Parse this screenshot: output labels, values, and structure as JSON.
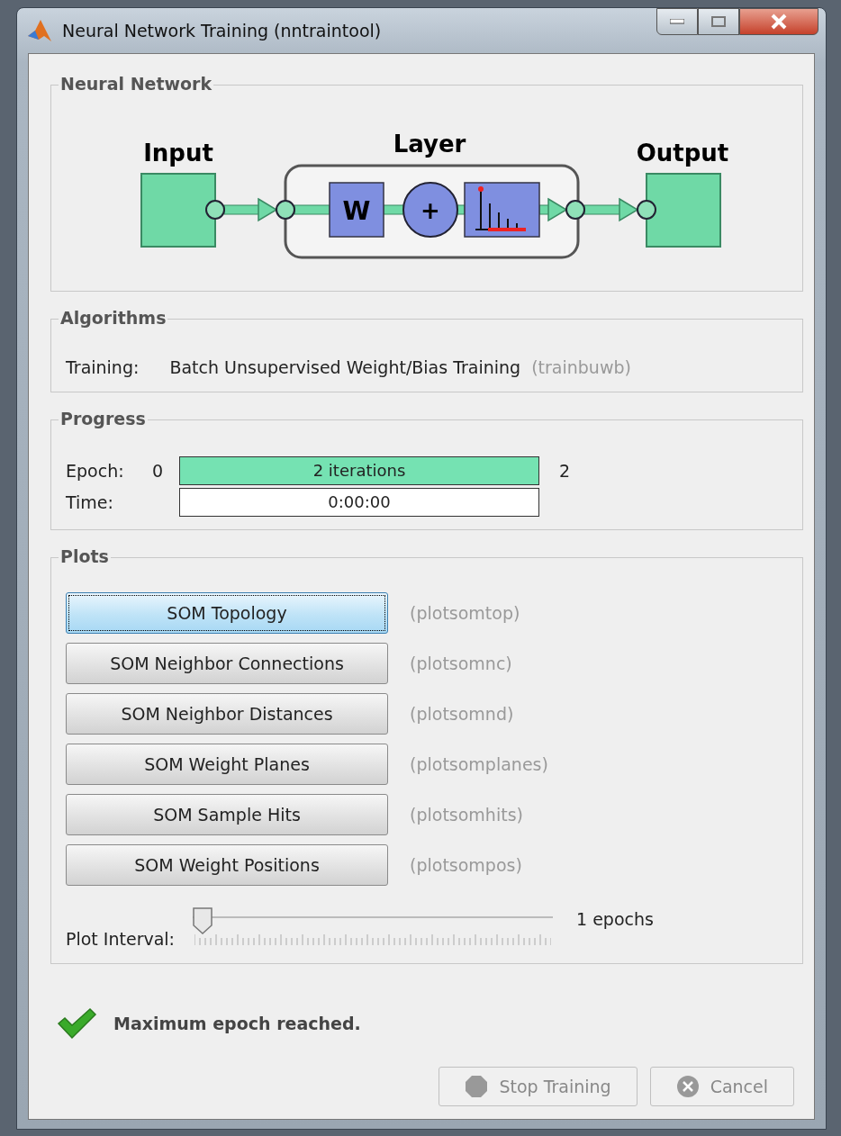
{
  "window": {
    "title": "Neural Network Training (nntraintool)"
  },
  "network": {
    "title": "Neural Network",
    "input_label": "Input",
    "layer_label": "Layer",
    "weight_label": "W",
    "sum_label": "+",
    "output_label": "Output"
  },
  "algorithms": {
    "title": "Algorithms",
    "rows": [
      {
        "label": "Training:",
        "value": "Batch Unsupervised Weight/Bias Training",
        "function": "(trainbuwb)"
      }
    ]
  },
  "progress": {
    "title": "Progress",
    "rows": [
      {
        "kind": "bar",
        "label": "Epoch:",
        "start": "0",
        "text": "2 iterations",
        "level": 1,
        "end": "2"
      },
      {
        "kind": "field",
        "label": "Time:",
        "text": "0:00:00"
      }
    ]
  },
  "plots": {
    "title": "Plots",
    "buttons": [
      {
        "label": "SOM Topology",
        "function": "(plotsomtop)",
        "selected": true
      },
      {
        "label": "SOM Neighbor Connections",
        "function": "(plotsomnc)",
        "selected": false
      },
      {
        "label": "SOM Neighbor Distances",
        "function": "(plotsomnd)",
        "selected": false
      },
      {
        "label": "SOM Weight Planes",
        "function": "(plotsomplanes)",
        "selected": false
      },
      {
        "label": "SOM Sample Hits",
        "function": "(plotsomhits)",
        "selected": false
      },
      {
        "label": "SOM Weight Positions",
        "function": "(plotsompos)",
        "selected": false
      }
    ],
    "interval": {
      "label": "Plot Interval:",
      "level": 0,
      "reading": "1 epochs"
    }
  },
  "status": {
    "message": "Maximum epoch reached."
  },
  "buttons": [
    {
      "kind": "stop",
      "label": "Stop Training",
      "disabled": true
    },
    {
      "kind": "cancel",
      "label": "Cancel",
      "disabled": true
    }
  ]
}
